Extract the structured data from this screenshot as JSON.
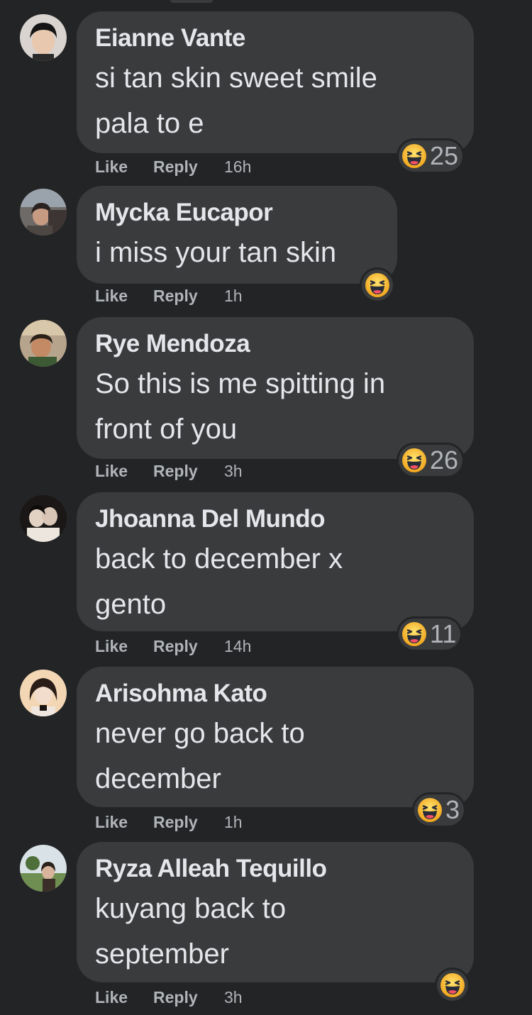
{
  "comments": [
    {
      "author": "Eianne Vante",
      "lines": [
        "si tan skin sweet smile",
        "pala to e"
      ],
      "like_label": "Like",
      "reply_label": "Reply",
      "time": "16h",
      "reaction_icon": "haha-emoji-icon",
      "reaction_count": "25"
    },
    {
      "author": "Mycka Eucapor",
      "lines": [
        "i miss your tan skin"
      ],
      "like_label": "Like",
      "reply_label": "Reply",
      "time": "1h",
      "reaction_icon": "haha-emoji-icon",
      "reaction_count": ""
    },
    {
      "author": "Rye Mendoza",
      "lines": [
        "So this is me spitting in",
        "front of you"
      ],
      "like_label": "Like",
      "reply_label": "Reply",
      "time": "3h",
      "reaction_icon": "haha-emoji-icon",
      "reaction_count": "26"
    },
    {
      "author": "Jhoanna Del Mundo",
      "lines": [
        "back to december x",
        "gento"
      ],
      "like_label": "Like",
      "reply_label": "Reply",
      "time": "14h",
      "reaction_icon": "haha-emoji-icon",
      "reaction_count": "11"
    },
    {
      "author": "Arisohma Kato",
      "lines": [
        "never go back to",
        "december"
      ],
      "like_label": "Like",
      "reply_label": "Reply",
      "time": "1h",
      "reaction_icon": "haha-emoji-icon",
      "reaction_count": "3"
    },
    {
      "author": "Ryza Alleah Tequillo",
      "lines": [
        "kuyang back to",
        "september"
      ],
      "like_label": "Like",
      "reply_label": "Reply",
      "time": "3h",
      "reaction_icon": "haha-emoji-icon",
      "reaction_count": ""
    }
  ],
  "colors": {
    "background": "#232426",
    "bubble": "#3a3b3c",
    "text_primary": "#e4e6eb",
    "text_secondary": "#b0b3b8",
    "emoji_face": "#f7b125"
  }
}
